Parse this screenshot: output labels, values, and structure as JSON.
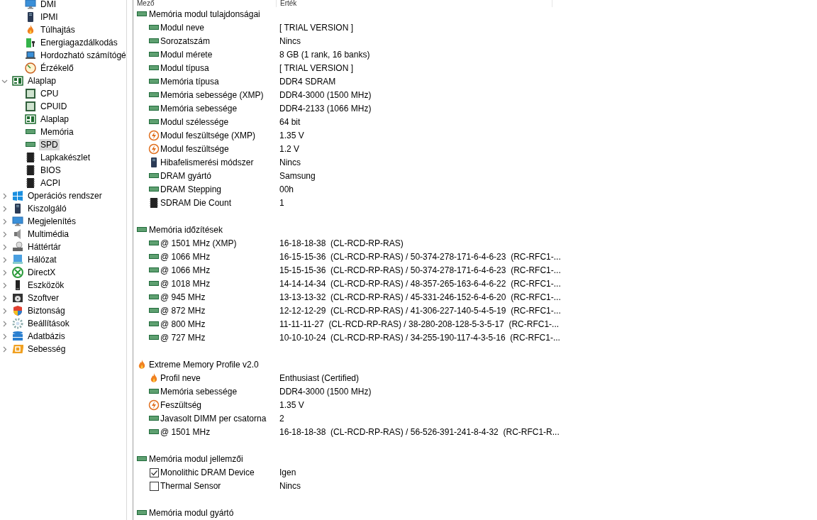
{
  "sidebar": {
    "items": [
      {
        "children": [
          {
            "label": "DMI",
            "kind": "monitor",
            "selected": false
          },
          {
            "label": "IPMI",
            "kind": "server",
            "selected": false
          },
          {
            "label": "Túlhajtás",
            "kind": "flame",
            "selected": false
          },
          {
            "label": "Energiagazdálkodás",
            "kind": "battery",
            "selected": false
          },
          {
            "label": "Hordozható számítógé",
            "kind": "laptop",
            "selected": false
          },
          {
            "label": "Érzékelő",
            "kind": "gauge",
            "selected": false
          }
        ]
      },
      {
        "label": "Alaplap",
        "kind": "board",
        "selected": false,
        "expanded": true,
        "children": [
          {
            "label": "CPU",
            "kind": "cpu",
            "selected": false
          },
          {
            "label": "CPUID",
            "kind": "cpu",
            "selected": false
          },
          {
            "label": "Alaplap",
            "kind": "board",
            "selected": false
          },
          {
            "label": "Memória",
            "kind": "ram",
            "selected": false
          },
          {
            "label": "SPD",
            "kind": "ram",
            "selected": true
          },
          {
            "label": "Lapkakészlet",
            "kind": "chip",
            "selected": false
          },
          {
            "label": "BIOS",
            "kind": "chip",
            "selected": false
          },
          {
            "label": "ACPI",
            "kind": "chip",
            "selected": false
          }
        ]
      },
      {
        "label": "Operációs rendszer",
        "kind": "windows",
        "selected": false,
        "expanded": false
      },
      {
        "label": "Kiszolgáló",
        "kind": "server",
        "selected": false,
        "expanded": false
      },
      {
        "label": "Megjelenítés",
        "kind": "monitor",
        "selected": false,
        "expanded": false
      },
      {
        "label": "Multimédia",
        "kind": "speaker",
        "selected": false,
        "expanded": false
      },
      {
        "label": "Háttértár",
        "kind": "disk",
        "selected": false,
        "expanded": false
      },
      {
        "label": "Hálózat",
        "kind": "network",
        "selected": false,
        "expanded": false
      },
      {
        "label": "DirectX",
        "kind": "xbox",
        "selected": false,
        "expanded": false
      },
      {
        "label": "Eszközök",
        "kind": "device",
        "selected": false,
        "expanded": false
      },
      {
        "label": "Szoftver",
        "kind": "software",
        "selected": false,
        "expanded": false
      },
      {
        "label": "Biztonság",
        "kind": "shield",
        "selected": false,
        "expanded": false
      },
      {
        "label": "Beállítások",
        "kind": "gear",
        "selected": false,
        "expanded": false
      },
      {
        "label": "Adatbázis",
        "kind": "database",
        "selected": false,
        "expanded": false
      },
      {
        "label": "Sebesség",
        "kind": "speed",
        "selected": false,
        "expanded": false
      }
    ]
  },
  "table": {
    "columns": [
      "Mező",
      "Érték"
    ],
    "sections": [
      {
        "title": "Memória modul tulajdonságai",
        "kind": "ram",
        "rows": [
          {
            "kind": "ram",
            "field": "Modul neve",
            "value": "[ TRIAL VERSION ]"
          },
          {
            "kind": "ram",
            "field": "Sorozatszám",
            "value": "Nincs"
          },
          {
            "kind": "ram",
            "field": "Modul mérete",
            "value": "8 GB (1 rank, 16 banks)"
          },
          {
            "kind": "ram",
            "field": "Modul típusa",
            "value": "[ TRIAL VERSION ]"
          },
          {
            "kind": "ram",
            "field": "Memória típusa",
            "value": "DDR4 SDRAM"
          },
          {
            "kind": "ram",
            "field": "Memória sebessége (XMP)",
            "value": "DDR4-3000 (1500 MHz)"
          },
          {
            "kind": "ram",
            "field": "Memória sebessége",
            "value": "DDR4-2133 (1066 MHz)"
          },
          {
            "kind": "ram",
            "field": "Modul szélessége",
            "value": "64 bit"
          },
          {
            "kind": "bolt",
            "field": "Modul feszültsége (XMP)",
            "value": "1.35 V"
          },
          {
            "kind": "bolt",
            "field": "Modul feszültsége",
            "value": "1.2 V"
          },
          {
            "kind": "server",
            "field": "Hibafelismerési módszer",
            "value": "Nincs"
          },
          {
            "kind": "ram",
            "field": "DRAM gyártó",
            "value": "Samsung"
          },
          {
            "kind": "ram",
            "field": "DRAM Stepping",
            "value": "00h"
          },
          {
            "kind": "chip",
            "field": "SDRAM Die Count",
            "value": "1"
          }
        ]
      },
      {
        "title": "Memória időzítések",
        "kind": "ram",
        "rows": [
          {
            "kind": "ram",
            "field": "@ 1501 MHz (XMP)",
            "value": "16-18-18-38  (CL-RCD-RP-RAS)"
          },
          {
            "kind": "ram",
            "field": "@ 1066 MHz",
            "value": "16-15-15-36  (CL-RCD-RP-RAS) / 50-374-278-171-6-4-6-23  (RC-RFC1-..."
          },
          {
            "kind": "ram",
            "field": "@ 1066 MHz",
            "value": "15-15-15-36  (CL-RCD-RP-RAS) / 50-374-278-171-6-4-6-23  (RC-RFC1-..."
          },
          {
            "kind": "ram",
            "field": "@ 1018 MHz",
            "value": "14-14-14-34  (CL-RCD-RP-RAS) / 48-357-265-163-6-4-6-22  (RC-RFC1-..."
          },
          {
            "kind": "ram",
            "field": "@ 945 MHz",
            "value": "13-13-13-32  (CL-RCD-RP-RAS) / 45-331-246-152-6-4-6-20  (RC-RFC1-..."
          },
          {
            "kind": "ram",
            "field": "@ 872 MHz",
            "value": "12-12-12-29  (CL-RCD-RP-RAS) / 41-306-227-140-5-4-5-19  (RC-RFC1-..."
          },
          {
            "kind": "ram",
            "field": "@ 800 MHz",
            "value": "11-11-11-27  (CL-RCD-RP-RAS) / 38-280-208-128-5-3-5-17  (RC-RFC1-..."
          },
          {
            "kind": "ram",
            "field": "@ 727 MHz",
            "value": "10-10-10-24  (CL-RCD-RP-RAS) / 34-255-190-117-4-3-5-16  (RC-RFC1-..."
          }
        ]
      },
      {
        "title": "Extreme Memory Profile v2.0",
        "kind": "flame",
        "rows": [
          {
            "kind": "flame",
            "field": "Profil neve",
            "value": "Enthusiast (Certified)"
          },
          {
            "kind": "ram",
            "field": "Memória sebessége",
            "value": "DDR4-3000 (1500 MHz)"
          },
          {
            "kind": "bolt",
            "field": "Feszültség",
            "value": "1.35 V"
          },
          {
            "kind": "ram",
            "field": "Javasolt DIMM per csatorna",
            "value": "2"
          },
          {
            "kind": "ram",
            "field": "@ 1501 MHz",
            "value": "16-18-18-38  (CL-RCD-RP-RAS) / 56-526-391-241-8-4-32  (RC-RFC1-R..."
          }
        ]
      },
      {
        "title": "Memória modul jellemzői",
        "kind": "ram",
        "rows": [
          {
            "kind": "checkbox",
            "checked": true,
            "field": "Monolithic DRAM Device",
            "value": "Igen"
          },
          {
            "kind": "checkbox",
            "checked": false,
            "field": "Thermal Sensor",
            "value": "Nincs"
          }
        ]
      },
      {
        "title": "Memória modul gyártó",
        "kind": "ram"
      }
    ]
  }
}
